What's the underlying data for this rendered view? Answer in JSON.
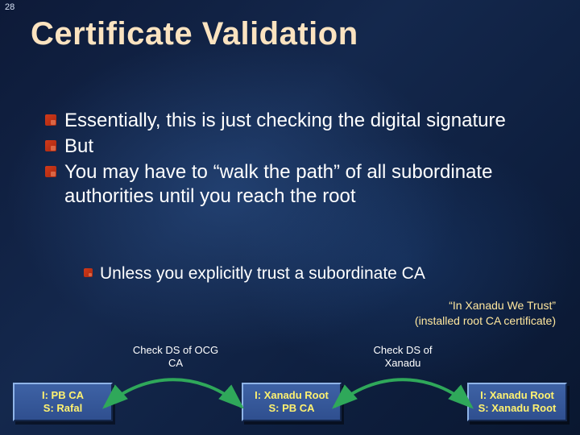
{
  "page_number": "28",
  "title": "Certificate Validation",
  "bullets_lvl1": [
    "Essentially, this is just checking the digital signature",
    "But",
    "You may have to “walk the path” of all subordinate authorities until you reach the root"
  ],
  "bullets_lvl2": [
    "Unless you explicitly trust a subordinate CA"
  ],
  "trust_caption_line1": "“In Xanadu We Trust”",
  "trust_caption_line2": "(installed root CA certificate)",
  "arrows": [
    {
      "label": "Check DS of OCG CA"
    },
    {
      "label": "Check DS of Xanadu"
    }
  ],
  "certs": [
    {
      "line1": "I: PB CA",
      "line2": "S: Rafal"
    },
    {
      "line1": "I: Xanadu Root",
      "line2": "S: PB CA"
    },
    {
      "line1": "I: Xanadu Root",
      "line2": "S: Xanadu Root"
    }
  ],
  "colors": {
    "title": "#fbe3c0",
    "cert_text": "#fff270",
    "caption": "#ffe79e",
    "arrow": "#2fa85a"
  }
}
